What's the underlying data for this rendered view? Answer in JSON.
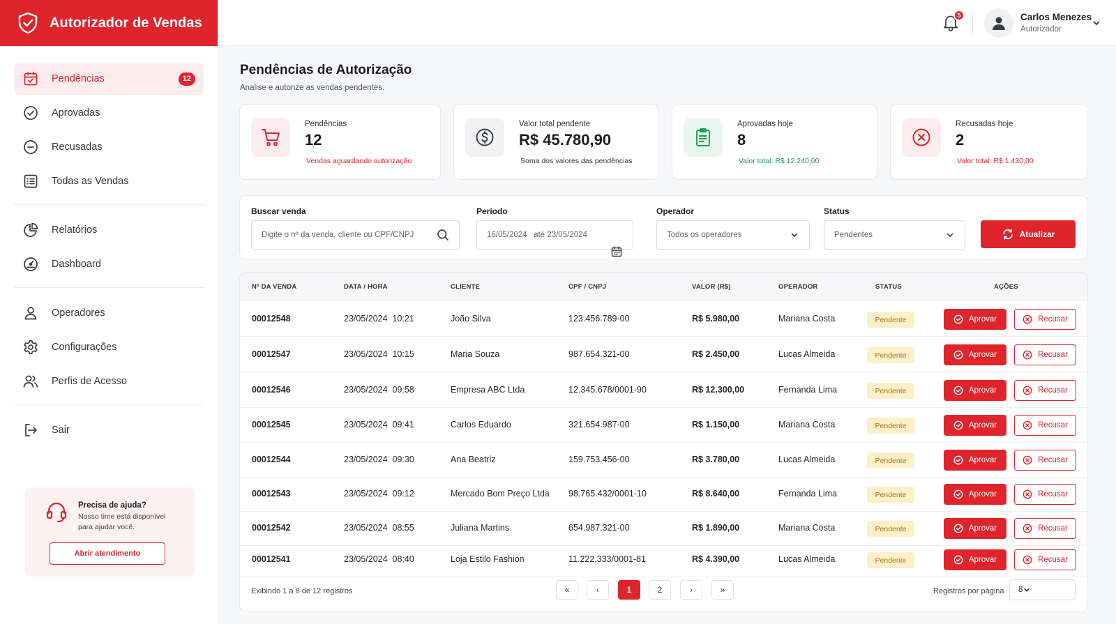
{
  "app": {
    "title": "Autorizador de Vendas"
  },
  "colors": {
    "accent": "#e0242c",
    "success": "#1f9d55",
    "pending_bg": "#fdf0c8",
    "pending_text": "#b0731a"
  },
  "sidebar": {
    "items": [
      {
        "label": "Pendências",
        "icon": "calendar-icon",
        "badge": "12",
        "active": true
      },
      {
        "label": "Aprovadas",
        "icon": "check-circle-icon"
      },
      {
        "label": "Recusadas",
        "icon": "minus-circle-icon"
      },
      {
        "label": "Todas as Vendas",
        "icon": "list-icon"
      },
      {
        "label": "Relatórios",
        "icon": "pie-chart-icon"
      },
      {
        "label": "Dashboard",
        "icon": "gauge-icon"
      },
      {
        "label": "Operadores",
        "icon": "user-icon"
      },
      {
        "label": "Configurações",
        "icon": "gear-icon"
      },
      {
        "label": "Perfis de Acesso",
        "icon": "users-icon"
      },
      {
        "label": "Sair",
        "icon": "logout-icon"
      }
    ],
    "help": {
      "title": "Precisa de ajuda?",
      "description": "Nosso time está disponível para ajudar você.",
      "button": "Abrir atendimento"
    }
  },
  "topbar": {
    "notifications": "5",
    "user_name": "Carlos Menezes",
    "user_role": "Autorizador"
  },
  "page": {
    "title": "Pendências de Autorização",
    "subtitle": "Analise e autorize as vendas pendentes."
  },
  "cards": [
    {
      "label": "Pendências",
      "value": "12",
      "foot": "Vendas aguardando autorização"
    },
    {
      "label": "Valor total pendente",
      "value": "R$ 45.780,90",
      "foot": "Soma dos valores das pendências"
    },
    {
      "label": "Aprovadas hoje",
      "value": "8",
      "foot": "Valor total: R$ 12.240,00"
    },
    {
      "label": "Recusadas hoje",
      "value": "2",
      "foot": "Valor total: R$ 1.430,00"
    }
  ],
  "filters": {
    "search": {
      "label": "Buscar venda",
      "placeholder": "Digite o nº da venda, cliente ou CPF/CNPJ"
    },
    "period": {
      "label": "Período",
      "value": "16/05/2024   até 23/05/2024"
    },
    "operator": {
      "label": "Operador",
      "value": "Todos os operadores"
    },
    "status": {
      "label": "Status",
      "value": "Pendentes"
    },
    "refresh": "Atualizar"
  },
  "table": {
    "columns": [
      "Nº DA VENDA",
      "DATA / HORA",
      "CLIENTE",
      "CPF / CNPJ",
      "VALOR (R$)",
      "OPERADOR",
      "STATUS",
      "AÇÕES"
    ],
    "rows": [
      {
        "id": "00012548",
        "date": "23/05/2024  10:21",
        "client": "João Silva",
        "doc": "123.456.789-00",
        "value": "R$ 5.980,00",
        "operator": "Mariana Costa",
        "status": "Pendente"
      },
      {
        "id": "00012547",
        "date": "23/05/2024  10:15",
        "client": "Maria Souza",
        "doc": "987.654.321-00",
        "value": "R$ 2.450,00",
        "operator": "Lucas Almeida",
        "status": "Pendente"
      },
      {
        "id": "00012546",
        "date": "23/05/2024  09:58",
        "client": "Empresa ABC Ltda",
        "doc": "12.345.678/0001-90",
        "value": "R$ 12.300,00",
        "operator": "Fernanda Lima",
        "status": "Pendente"
      },
      {
        "id": "00012545",
        "date": "23/05/2024  09:41",
        "client": "Carlos Eduardo",
        "doc": "321.654.987-00",
        "value": "R$ 1.150,00",
        "operator": "Mariana Costa",
        "status": "Pendente"
      },
      {
        "id": "00012544",
        "date": "23/05/2024  09:30",
        "client": "Ana Beatriz",
        "doc": "159.753.456-00",
        "value": "R$ 3.780,00",
        "operator": "Lucas Almeida",
        "status": "Pendente"
      },
      {
        "id": "00012543",
        "date": "23/05/2024  09:12",
        "client": "Mercado Bom Preço Ltda",
        "doc": "98.765.432/0001-10",
        "value": "R$ 8.640,00",
        "operator": "Fernanda Lima",
        "status": "Pendente"
      },
      {
        "id": "00012542",
        "date": "23/05/2024  08:55",
        "client": "Juliana Martins",
        "doc": "654.987.321-00",
        "value": "R$ 1.890,00",
        "operator": "Mariana Costa",
        "status": "Pendente"
      },
      {
        "id": "00012541",
        "date": "23/05/2024  08:40",
        "client": "Loja Estilo Fashion",
        "doc": "11.222.333/0001-81",
        "value": "R$ 4.390,00",
        "operator": "Lucas Almeida",
        "status": "Pendente"
      }
    ],
    "approve_label": "Aprovar",
    "reject_label": "Recusar"
  },
  "pagination": {
    "info": "Exibindo 1 a 8 de 12 registros",
    "first": "«",
    "prev": "‹",
    "pages": [
      "1",
      "2"
    ],
    "next": "›",
    "last": "»",
    "per_page_label": "Registros por página",
    "per_page_value": "8"
  }
}
